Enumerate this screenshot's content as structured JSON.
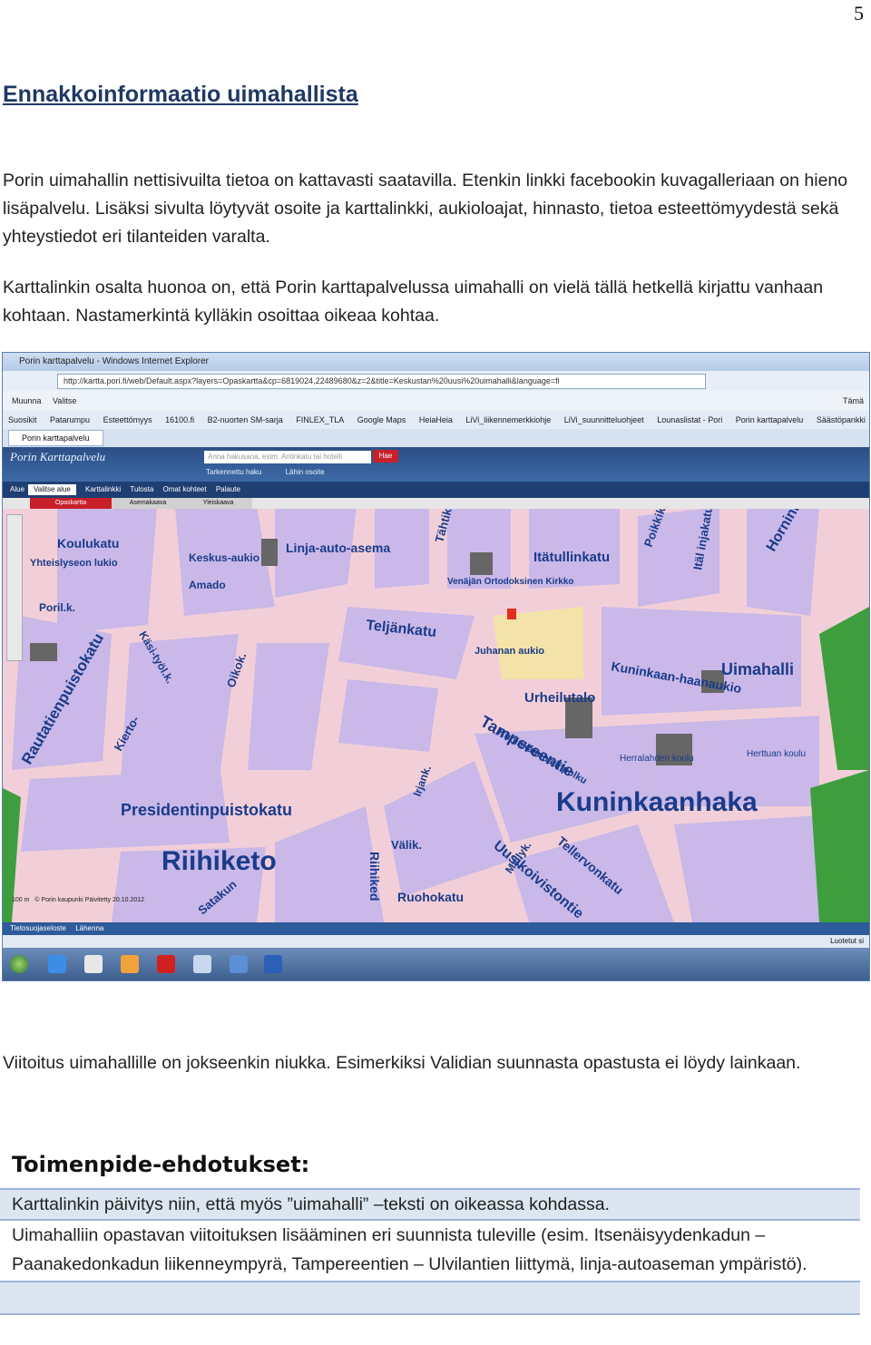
{
  "page_number": "5",
  "title": "Ennakkoinformaatio uimahallista",
  "paragraph1": "Porin uimahallin nettisivuilta tietoa on kattavasti saatavilla. Etenkin linkki facebookin kuvagalleriaan on hieno lisäpalvelu. Lisäksi sivulta löytyvät osoite ja karttalinkki, aukioloajat, hinnasto, tietoa esteettömyydestä sekä yhteystiedot eri tilanteiden varalta.",
  "paragraph2": "Karttalinkin osalta huonoa on, että Porin karttapalvelussa uimahalli on vielä tällä hetkellä kirjattu vanhaan kohtaan. Nastamerkintä kylläkin osoittaa oikeaa kohtaa.",
  "screenshot": {
    "window_title": "Porin karttapalvelu - Windows Internet Explorer",
    "address": "http://kartta.pori.fi/web/Default.aspx?layers=Opaskartta&cp=6819024,22489680&z=2&title=Keskustan%20uusi%20uimahalli&language=fi",
    "menu": [
      "Muunna",
      "Valitse",
      "Tämä"
    ],
    "favorites": [
      "Suosikit",
      "Patarumpu",
      "Esteettömyys",
      "16100.fi",
      "B2-nuorten SM-sarja",
      "FINLEX_TLA",
      "Google Maps",
      "HeiaHeia",
      "LiVi_liikennemerkkiohje",
      "LiVi_suunnitteluohjeet",
      "Lounaslistat - Pori",
      "Porin karttapalvelu",
      "Säästöpankki"
    ],
    "tab_label": "Porin karttapalvelu",
    "site_logo": "Porin Karttapalvelu",
    "search_placeholder": "Anna hakusana, esim. Antinkatu tai hotelli",
    "search_button": "Hae",
    "site_links": [
      "Tarkennettu haku",
      "Lähin osoite"
    ],
    "map_nav": [
      "Alue",
      "Karttalinkki",
      "Tulosta",
      "Omat kohteet",
      "Palaute"
    ],
    "area_select": "Valitse alue",
    "layer_buttons": [
      "Opaskartta",
      "Asemakaava",
      "Yleiskaava"
    ],
    "map_labels": [
      "Riihiketo",
      "Kuninkaanhaka",
      "Uimahalli",
      "Presidentinpuistokatu",
      "Rautatienpuistokatu",
      "Teljänkatu",
      "Tampereentie",
      "Uusikoivistontie",
      "Linja-auto-asema",
      "Itätullinkatu",
      "Urheilutalo",
      "Kuninkaan-haanaukio",
      "Juhanan aukio",
      "Kuninkaanhaanpolku",
      "Ruohokatu",
      "Tellervonkatu",
      "Hornink",
      "Yhteislyseon lukio",
      "Koulukatu",
      "Keskus-aukio",
      "Amado",
      "Oikok.",
      "Herralahden koulu",
      "Herttuan koulu",
      "Venäjän Ortodoksinen Kirkko",
      "Tähtikatu",
      "Itäl injakatu",
      "Poikkik",
      "Välik.",
      "Riihiked",
      "Satakun",
      "Kierto-",
      "Käsi-työl.k.",
      "Poril.k.",
      "Irjank.",
      "Myllyk."
    ],
    "scale": "100 m",
    "copyright": "© Porin kaupunki Päivitetty 20.10.2012",
    "footer_link": "Tietosuojaseloste",
    "footer_link2": "Lähenna",
    "status_right": "Luotetut si"
  },
  "paragraph3": "Viitoitus uimahallille on jokseenkin niukka. Esimerkiksi Validian suunnasta opastusta ei löydy lainkaan.",
  "toimenpide": {
    "title": "Toimenpide-ehdotukset:",
    "items": [
      "Karttalinkin päivitys niin, että myös ”uimahalli” –teksti on oikeassa kohdassa.",
      "Uimahalliin opastavan viitoituksen  lisääminen eri suunnista tuleville (esim. Itsenäisyydenkadun – Paanakedonkadun liikenneympyrä, Tampereentien – Ulvilantien liittymä, linja-autoaseman ympäristö)."
    ]
  },
  "colors": {
    "title": "#1f3864",
    "map_block": "#c9b8e8",
    "map_road": "#f2cfd8",
    "map_green": "#3e9e3e",
    "map_highlight": "#f3e3a8",
    "table_shade": "#dce6f1"
  }
}
